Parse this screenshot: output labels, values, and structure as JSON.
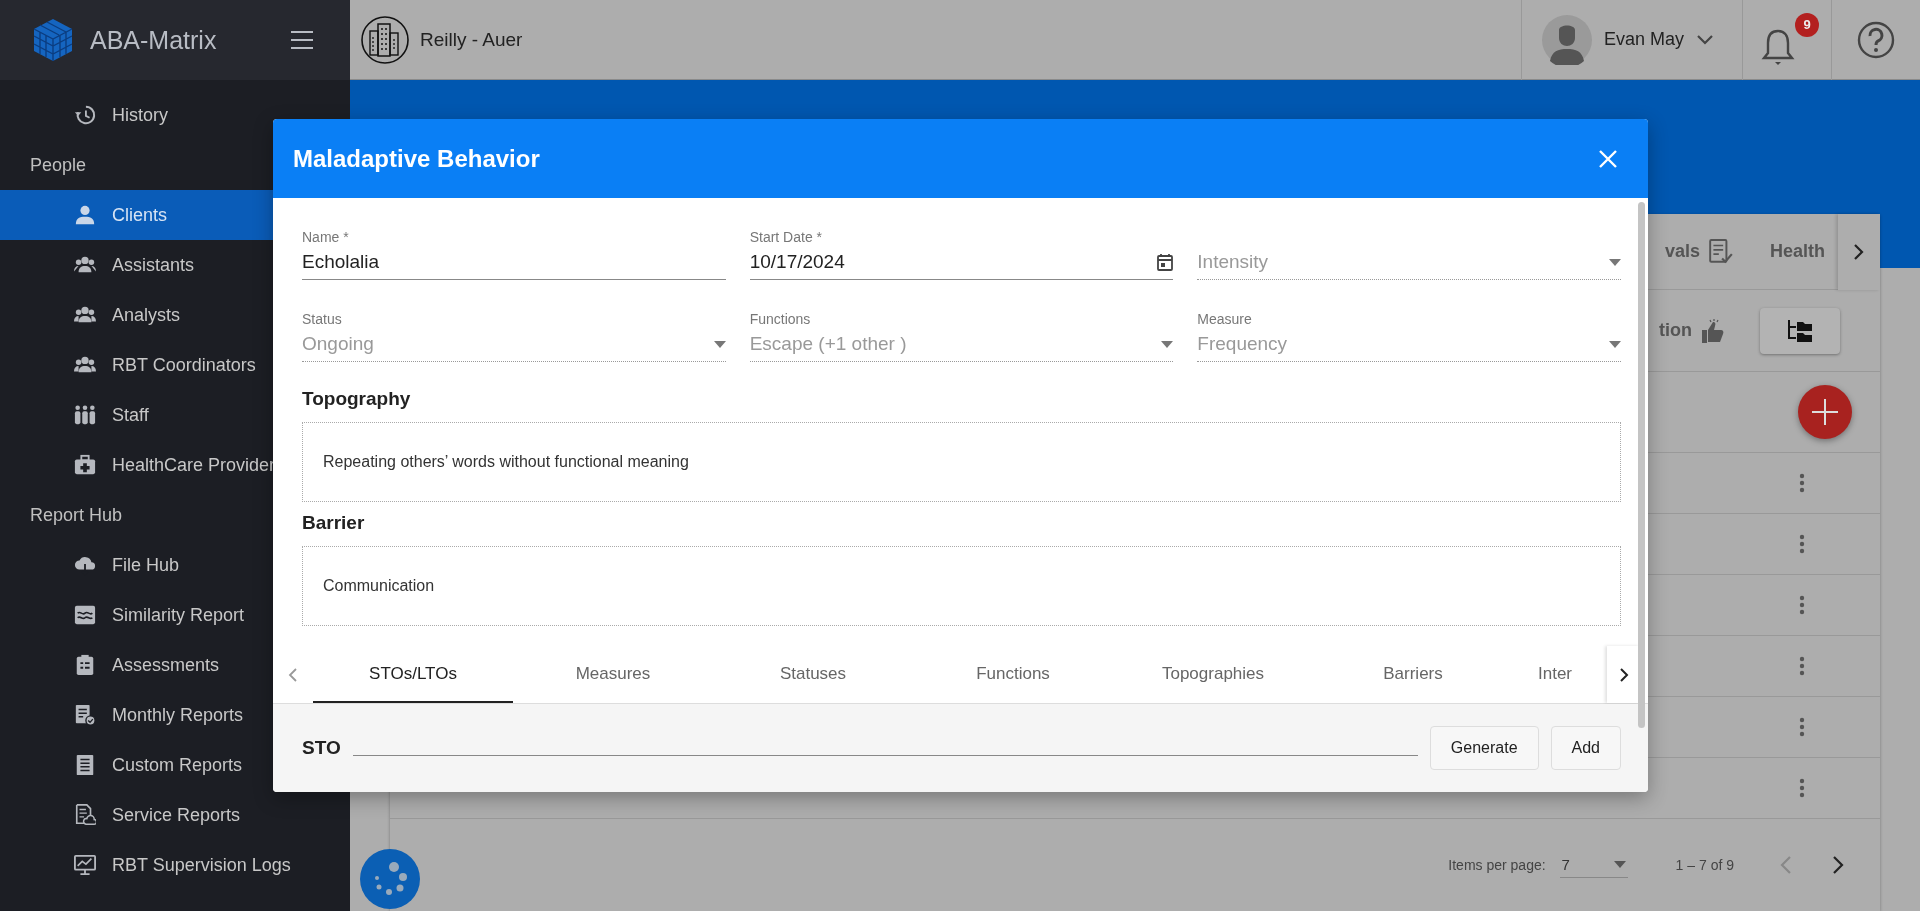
{
  "sidebar": {
    "brand": "ABA-Matrix",
    "items": [
      {
        "kind": "link",
        "label": "History",
        "selected": false
      },
      {
        "kind": "section",
        "label": "People"
      },
      {
        "kind": "link",
        "label": "Clients",
        "selected": true
      },
      {
        "kind": "link",
        "label": "Assistants",
        "selected": false
      },
      {
        "kind": "link",
        "label": "Analysts",
        "selected": false
      },
      {
        "kind": "link",
        "label": "RBT Coordinators",
        "selected": false
      },
      {
        "kind": "link",
        "label": "Staff",
        "selected": false
      },
      {
        "kind": "link",
        "label": "HealthCare Provider",
        "selected": false
      },
      {
        "kind": "section",
        "label": "Report Hub"
      },
      {
        "kind": "link",
        "label": "File Hub",
        "selected": false
      },
      {
        "kind": "link",
        "label": "Similarity Report",
        "selected": false
      },
      {
        "kind": "link",
        "label": "Assessments",
        "selected": false
      },
      {
        "kind": "link",
        "label": "Monthly Reports",
        "selected": false
      },
      {
        "kind": "link",
        "label": "Custom Reports",
        "selected": false
      },
      {
        "kind": "link",
        "label": "Service Reports",
        "selected": false
      },
      {
        "kind": "link",
        "label": "RBT Supervision Logs",
        "selected": false
      }
    ]
  },
  "topbar": {
    "organization": "Reilly - Auer",
    "user": "Evan May",
    "notifications": "9"
  },
  "background": {
    "tabs": [
      "vals",
      "Health"
    ],
    "toolbar_label": "tion",
    "paginator": {
      "label": "Items per page:",
      "page_size": "7",
      "range": "1 – 7 of 9"
    }
  },
  "dialog": {
    "title": "Maladaptive Behavior",
    "fields": [
      {
        "kind": "text",
        "label": "Name *",
        "value": "Echolalia",
        "disabled": false
      },
      {
        "kind": "date",
        "label": "Start Date *",
        "value": "10/17/2024",
        "disabled": false
      },
      {
        "kind": "select",
        "placeholder": "Intensity",
        "disabled": true
      },
      {
        "kind": "select",
        "label": "Status",
        "value": "Ongoing",
        "disabled": true
      },
      {
        "kind": "select",
        "label": "Functions",
        "value": "Escape (+1 other )",
        "disabled": true
      },
      {
        "kind": "select",
        "label": "Measure",
        "value": "Frequency",
        "disabled": true
      }
    ],
    "sections": [
      {
        "heading": "Topography",
        "text": "Repeating others’ words without functional meaning"
      },
      {
        "heading": "Barrier",
        "text": "Communication"
      }
    ],
    "tabs": [
      {
        "label": "STOs/LTOs",
        "selected": true
      },
      {
        "label": "Measures",
        "selected": false
      },
      {
        "label": "Statuses",
        "selected": false
      },
      {
        "label": "Functions",
        "selected": false
      },
      {
        "label": "Topographies",
        "selected": false
      },
      {
        "label": "Barriers",
        "selected": false
      },
      {
        "label": "Inter",
        "selected": false
      }
    ],
    "sto": {
      "label": "STO",
      "buttons": [
        "Generate",
        "Add"
      ]
    }
  }
}
